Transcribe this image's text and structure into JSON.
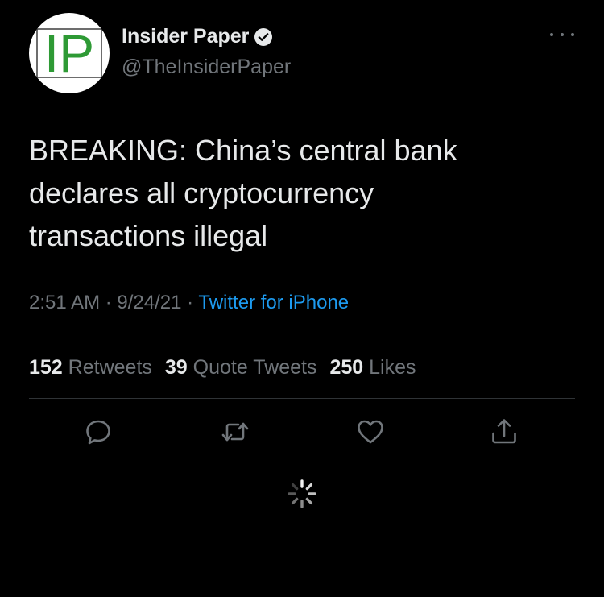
{
  "author": {
    "avatar_text": "IP",
    "name": "Insider Paper",
    "handle": "@TheInsiderPaper",
    "verified": true
  },
  "tweet": {
    "text_lines": [
      "BREAKING: China’s central bank",
      "declares all cryptocurrency",
      "transactions illegal"
    ],
    "time": "2:51 AM",
    "date": "9/24/21",
    "separator": "·",
    "source": "Twitter for iPhone"
  },
  "stats": {
    "retweets_count": "152",
    "retweets_label": "Retweets",
    "quotes_count": "39",
    "quotes_label": "Quote Tweets",
    "likes_count": "250",
    "likes_label": "Likes"
  },
  "icons": {
    "reply": "reply-icon",
    "retweet": "retweet-icon",
    "like": "heart-icon",
    "share": "share-icon",
    "more": "more-icon",
    "loading": "loading-spinner-icon",
    "verified": "verified-badge-icon"
  },
  "colors": {
    "background": "#000000",
    "text": "#e7e9ea",
    "secondary": "#71767b",
    "link": "#1d9bf0",
    "avatar_green": "#2e9a35"
  }
}
